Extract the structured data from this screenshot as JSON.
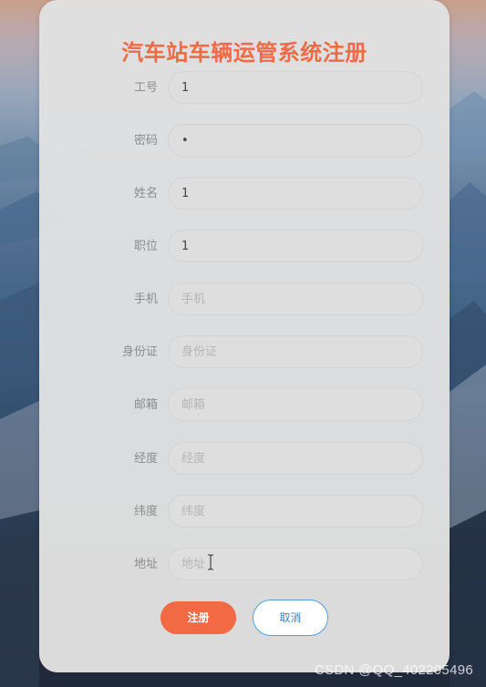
{
  "page": {
    "title": "汽车站车辆运管系统注册"
  },
  "form": {
    "fields": [
      {
        "label": "工号",
        "value": "1",
        "placeholder": ""
      },
      {
        "label": "密码",
        "value": "•",
        "placeholder": ""
      },
      {
        "label": "姓名",
        "value": "1",
        "placeholder": ""
      },
      {
        "label": "职位",
        "value": "1",
        "placeholder": ""
      },
      {
        "label": "手机",
        "value": "",
        "placeholder": "手机"
      },
      {
        "label": "身份证",
        "value": "",
        "placeholder": "身份证"
      },
      {
        "label": "邮箱",
        "value": "",
        "placeholder": "邮箱"
      },
      {
        "label": "经度",
        "value": "",
        "placeholder": "经度"
      },
      {
        "label": "纬度",
        "value": "",
        "placeholder": "纬度"
      },
      {
        "label": "地址",
        "value": "",
        "placeholder": "地址"
      }
    ],
    "buttons": {
      "register": "注册",
      "cancel": "取消"
    }
  },
  "watermark": "CSDN @QQ_402205496",
  "colors": {
    "title": "#f06a45",
    "register_bg": "#f26a43",
    "cancel_border": "#4f9fe6"
  }
}
